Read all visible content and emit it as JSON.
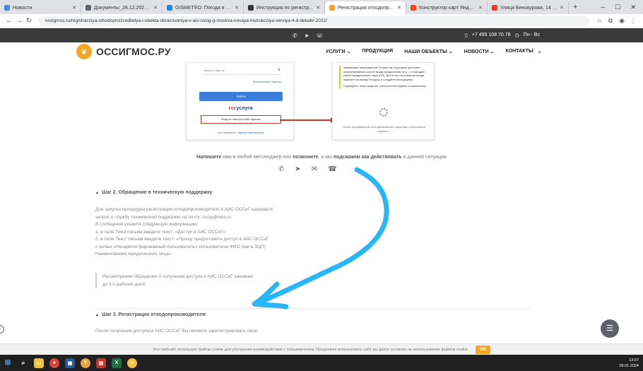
{
  "browser": {
    "tabs": [
      {
        "title": "Новости",
        "color": "#4285f4",
        "active": false
      },
      {
        "title": "Документы_28.12.2023_15_09...",
        "color": "#5f6368",
        "active": false
      },
      {
        "title": "GISMETEO: Погода в Москве...",
        "color": "#1e88e5",
        "active": false
      },
      {
        "title": "Инструкция по регистрации...",
        "color": "#333333",
        "active": false
      },
      {
        "title": "Регистрация отходопроизводи...",
        "color": "#f5a623",
        "active": true
      },
      {
        "title": "Конструктор карт Яндекса",
        "color": "#fc3f1d",
        "active": false
      },
      {
        "title": "Улица Бинокурова, 14 на карте",
        "color": "#e53935",
        "active": false
      }
    ],
    "url": "ossigmos.ru/registracziya-othodoproizvoditelya-i-obekta-obrazovaniya-v-ais-ossig-g-moskva-novaya-instrukcziya-versiya-4-8-dekabr-2022/"
  },
  "topbar": {
    "phone": "+7 495 108 70 78",
    "hours": "Пн - Вс"
  },
  "header": {
    "logo_text": "ОССИГМОС.РУ",
    "menu": [
      "УСЛУГИ ⌄",
      "ПРОДУКЦИЯ",
      "НАШИ ОБЪЕКТЫ ⌄",
      "НОВОСТИ ⌄",
      "КОНТАКТЫ"
    ]
  },
  "screenshot1": {
    "select_placeholder": "Введите пароль",
    "restore_link": "Восстановить пароль",
    "login_button": "Войти",
    "gos_left": "гос",
    "gos_right": "услуги",
    "ep_button": "Вход по электронной подписи",
    "no_account": "Нет аккаунта?",
    "register_link": "Зарегистрироваться"
  },
  "screenshot2": {
    "warning": "Уважаемые пользователи! Теперь на Госуслугах доступен альтернативный способ входа юридических лиц – с помощью ключа юридического лица (ЭП). Для этого на странице входа нажмите на кнопку Ресурсы и следуйте инструкциям.",
    "plugin_note": "Подождите, пока средство электронной подписи к компьютеру.",
    "footer": "Поиск сертификатов на подключенных средствах электронной подписи..."
  },
  "cta": {
    "b1": "Напишите",
    "t1": " нам в любой мессенджер или ",
    "b2": "позвоните",
    "t2": ", а мы ",
    "b3": "подскажем как действовать",
    "t3": " в данной ситуации"
  },
  "step2": {
    "heading": "Шаг 2. Обращение в техническую поддержку",
    "lines": [
      "Для запуска процедуры регистрации отходопроизводителя в АИС ОССиГ направьте",
      "запрос в службу технической поддержки на почту: ossig@mos.ru",
      "В сообщении укажите следующую информацию:",
      "1. в поле Тема письма введите текст: «Доступ в АИС ОССиГ»;",
      "2. в поле Текст письма введите текст: «Прошу предоставить доступ в АИС ОССиГ",
      "с ролью «Незарегистрированный пользователь» пользователю ФИО (как в ЭЦП)",
      "Наименование юридического лица»."
    ],
    "quote_line1": "Рассмотрение обращения о получении доступа к АИС ОССиГ занимает",
    "quote_line2": "до 3-х рабочих дней"
  },
  "step3": {
    "heading": "Шаг 3. Регистрация отходопроизводителя",
    "text": "После получения доступа в АИС ОССиГ Вы сможете зарегистрировать свою"
  },
  "cookie": {
    "text": "Этот вебсайт использует файлы cookie для улучшения взаимодействия с пользователем. Продолжая использовать сайт, вы даете согласие на использование файлов cookie.",
    "ok": "OK"
  },
  "taskbar": {
    "time": "13:07",
    "date": "09.01.2024"
  },
  "colors": {
    "accent": "#f5a623",
    "annotation": "#29b6f6",
    "red_box": "#c0392b"
  }
}
